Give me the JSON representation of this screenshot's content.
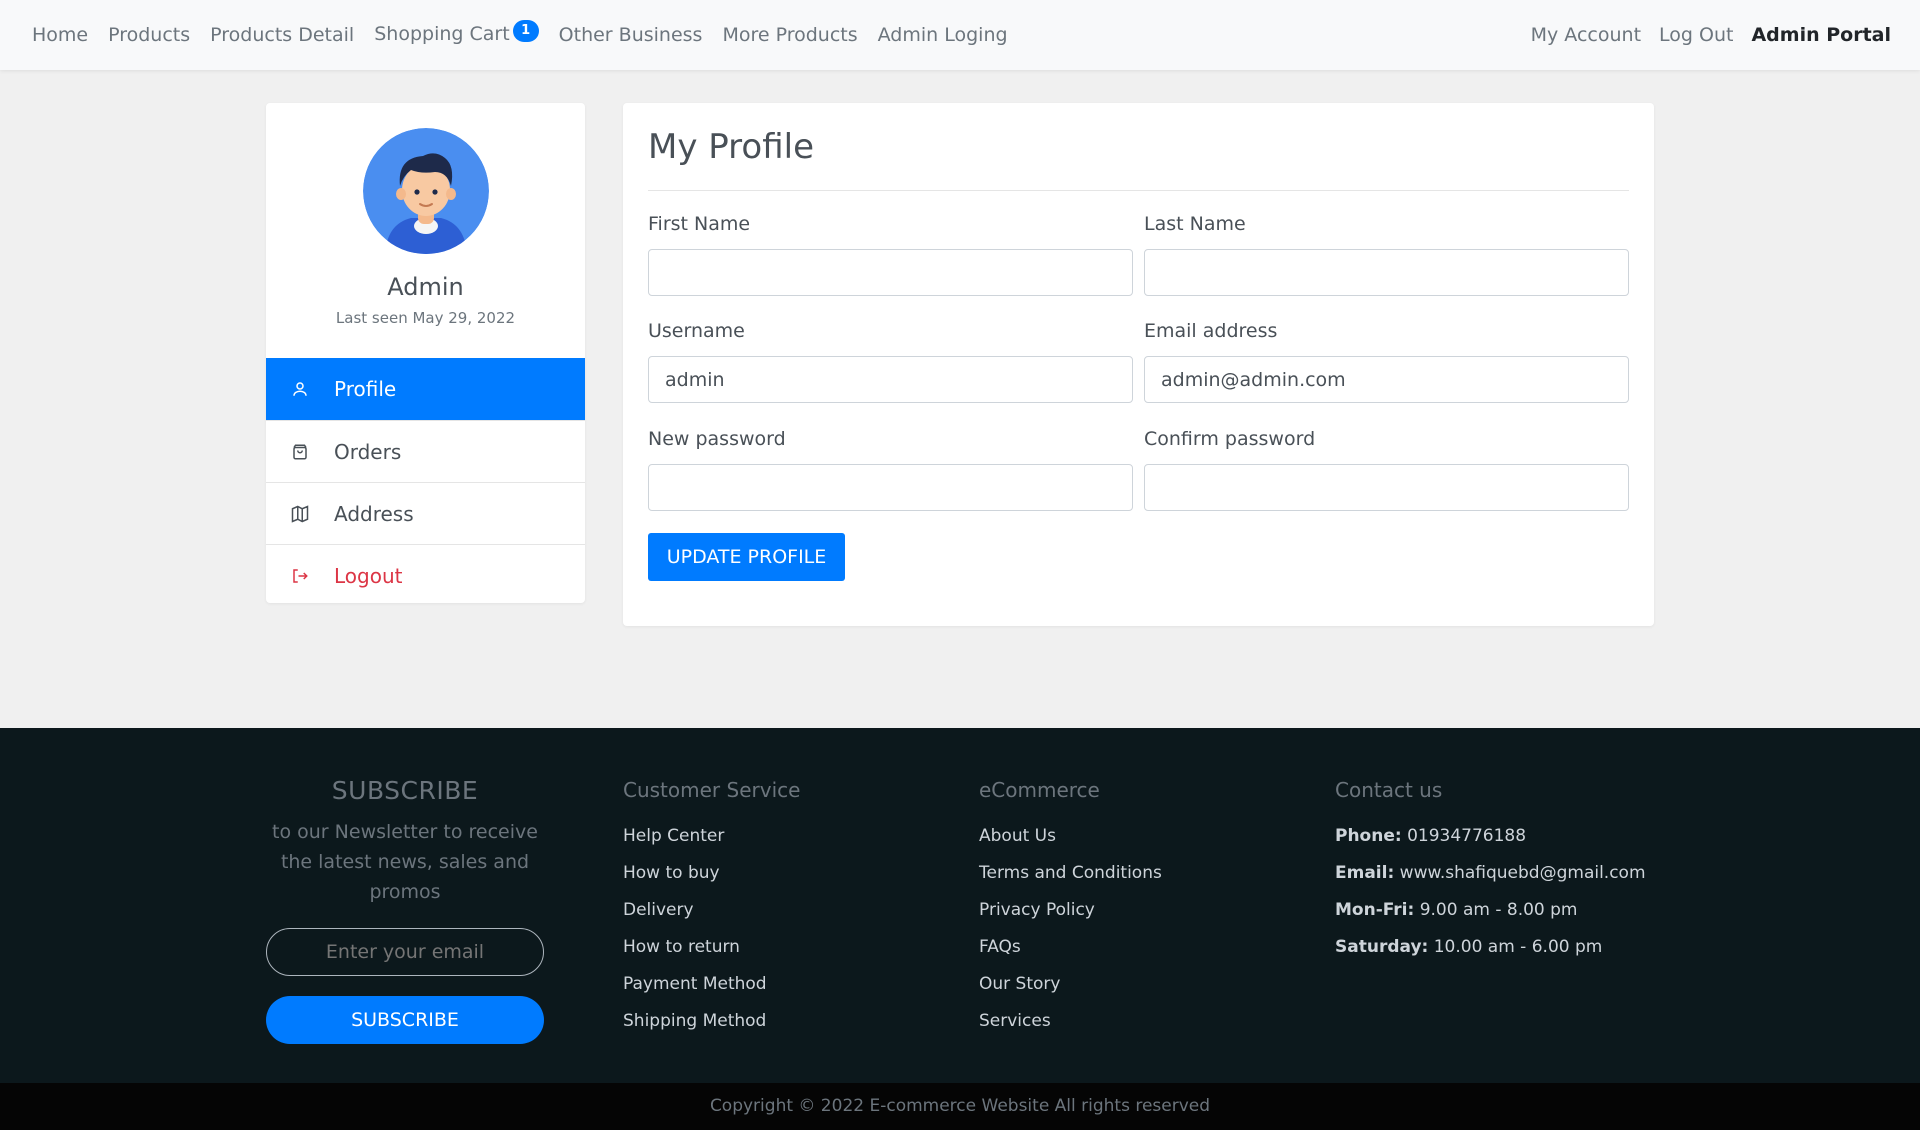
{
  "navbar": {
    "left": [
      "Home",
      "Products",
      "Products Detail",
      "Shopping Cart",
      "Other Business",
      "More Products",
      "Admin Loging"
    ],
    "cart_count": "1",
    "right": [
      "My Account",
      "Log Out"
    ],
    "admin_portal": "Admin Portal"
  },
  "sidebar": {
    "name": "Admin",
    "last_seen": "Last seen May 29, 2022",
    "items": [
      {
        "label": "Profile",
        "icon": "user-icon"
      },
      {
        "label": "Orders",
        "icon": "shopping-bag-icon"
      },
      {
        "label": "Address",
        "icon": "map-icon"
      },
      {
        "label": "Logout",
        "icon": "logout-icon"
      }
    ]
  },
  "profile": {
    "title": "My Profile",
    "first_name_label": "First Name",
    "first_name_value": "",
    "last_name_label": "Last Name",
    "last_name_value": "",
    "username_label": "Username",
    "username_value": "admin",
    "email_label": "Email address",
    "email_value": "admin@admin.com",
    "new_password_label": "New password",
    "confirm_password_label": "Confirm password",
    "update_button": "UPDATE PROFILE"
  },
  "footer": {
    "subscribe_title": "SUBSCRIBE",
    "subscribe_text": "to our Newsletter to receive the latest news, sales and promos",
    "email_placeholder": "Enter your email",
    "subscribe_button": "SUBSCRIBE",
    "customer_service": {
      "heading": "Customer Service",
      "links": [
        "Help Center",
        "How to buy",
        "Delivery",
        "How to return",
        "Payment Method",
        "Shipping Method"
      ]
    },
    "ecommerce": {
      "heading": "eCommerce",
      "links": [
        "About Us",
        "Terms and Conditions",
        "Privacy Policy",
        "FAQs",
        "Our Story",
        "Services"
      ]
    },
    "contact": {
      "heading": "Contact us",
      "phone_label": "Phone:",
      "phone": "01934776188",
      "email_label": "Email:",
      "email": "www.shafiquebd@gmail.com",
      "monfri_label": "Mon-Fri:",
      "monfri": "9.00 am - 8.00 pm",
      "saturday_label": "Saturday:",
      "saturday": "10.00 am - 6.00 pm"
    },
    "copyright": "Copyright © 2022 E-commerce Website All rights reserved"
  },
  "colors": {
    "primary": "#007bff",
    "danger": "#dc3545",
    "footer_bg": "#0c181c",
    "page_bg": "#f0f0f0"
  }
}
